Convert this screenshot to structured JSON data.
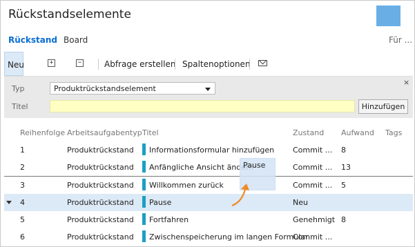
{
  "header": {
    "title": "Rückstandselemente"
  },
  "tabs": {
    "backlog": "Rückstand",
    "board": "Board",
    "more": "Für ..."
  },
  "toolbar": {
    "new_label": "Neu",
    "expand_label": "+",
    "collapse_label": "−",
    "create_query": "Abfrage erstellen",
    "column_options": "Spaltenoptionen"
  },
  "form": {
    "type_label": "Typ",
    "type_value": "Produktrückstandselement",
    "title_label": "Titel",
    "title_value": "",
    "add_button": "Hinzufügen",
    "close_label": "×"
  },
  "table": {
    "headers": {
      "order": "Reihenfolge",
      "work_item_type": "Arbeitsaufgabentyp",
      "title": "Titel",
      "state": "Zustand",
      "effort": "Aufwand",
      "tags": "Tags"
    },
    "rows": [
      {
        "order": "1",
        "type": "Produktrückstand",
        "title": "Informationsformular hinzufügen",
        "state": "Commit ...",
        "effort": "8"
      },
      {
        "order": "2",
        "type": "Produktrückstand",
        "title": "Anfängliche Ansicht ändern",
        "state": "Commit ...",
        "effort": "13"
      },
      {
        "order": "3",
        "type": "Produktrückstand",
        "title": "Willkommen zurück",
        "state": "Commit ...",
        "effort": "5"
      },
      {
        "order": "4",
        "type": "Produktrückstand",
        "title": "Pause",
        "state": "Neu",
        "effort": ""
      },
      {
        "order": "5",
        "type": "Produktrückstand",
        "title": "Fortfahren",
        "state": "Genehmigt",
        "effort": "8"
      },
      {
        "order": "6",
        "type": "Produktrückstand",
        "title": "Zwischenspeicherung im langen Formular",
        "state": "Commit ...",
        "effort": ""
      }
    ]
  },
  "drag_ghost": {
    "label": "Pause"
  },
  "colors": {
    "accent": "#0a6ed1",
    "selected_row": "#dce9f6",
    "item_bar": "#1d9fc3",
    "drag_arrow": "#f08a24",
    "title_input_bg": "#ffffc4"
  },
  "icons": [
    "expand-all-icon",
    "collapse-all-icon",
    "email-icon",
    "close-icon",
    "row-arrow-icon",
    "drag-arrow-icon"
  ]
}
